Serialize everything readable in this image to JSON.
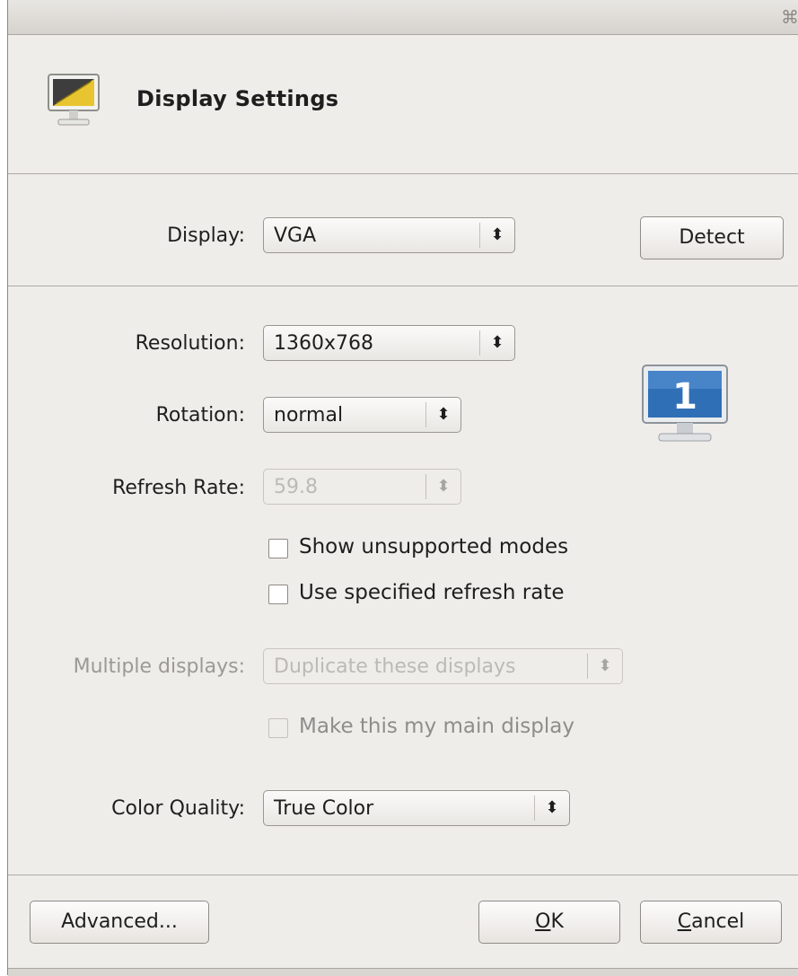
{
  "dialog": {
    "title": "Display Settings",
    "icon": "display-settings-icon"
  },
  "display": {
    "label": "Display:",
    "value": "VGA",
    "detect_button": "Detect"
  },
  "resolution": {
    "label": "Resolution:",
    "value": "1360x768"
  },
  "rotation": {
    "label": "Rotation:",
    "value": "normal"
  },
  "refresh_rate": {
    "label": "Refresh Rate:",
    "value": "59.8",
    "enabled": false
  },
  "checkboxes": {
    "show_unsupported": {
      "label": "Show unsupported modes",
      "checked": false
    },
    "use_refresh": {
      "label": "Use specified refresh rate",
      "checked": false
    },
    "main_display": {
      "label": "Make this my main display",
      "checked": false,
      "enabled": false
    }
  },
  "multiple_displays": {
    "label": "Multiple displays:",
    "value": "Duplicate these displays",
    "enabled": false
  },
  "color_quality": {
    "label": "Color Quality:",
    "value": "True Color"
  },
  "monitor_preview": {
    "number": "1"
  },
  "footer": {
    "advanced_button": "Advanced...",
    "ok_button_mnemonic": "O",
    "ok_button_rest": "K",
    "cancel_button_mnemonic": "C",
    "cancel_button_rest": "ancel"
  },
  "colors": {
    "accent_blue": "#2f6fb6",
    "icon_yellow": "#e8c530",
    "window_bg": "#efedea"
  }
}
